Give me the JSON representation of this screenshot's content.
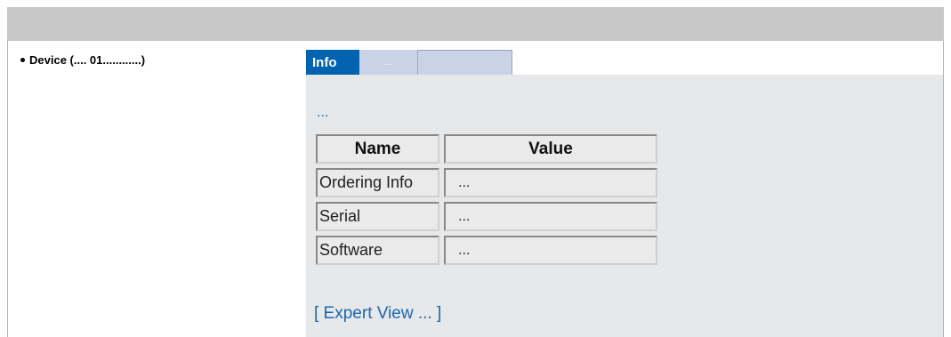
{
  "sidebar": {
    "device_label": "Device (.... 01............)"
  },
  "tabs": [
    {
      "label": "Info",
      "active": true
    },
    {
      "label": "...",
      "active": false
    },
    {
      "label": "",
      "active": false
    }
  ],
  "panel": {
    "link_text": "...",
    "table": {
      "headers": [
        "Name",
        "Value"
      ],
      "rows": [
        {
          "name": "Ordering Info",
          "value": "..."
        },
        {
          "name": "Serial",
          "value": "..."
        },
        {
          "name": "Software",
          "value": "..."
        }
      ]
    },
    "expert_link": "[ Expert View ... ]"
  },
  "colors": {
    "topbar": "#c8c8c8",
    "active_tab": "#0063b0",
    "inactive_tab": "#c8d3e8",
    "panel_bg": "#e7e8ea",
    "link": "#1a66b3"
  }
}
